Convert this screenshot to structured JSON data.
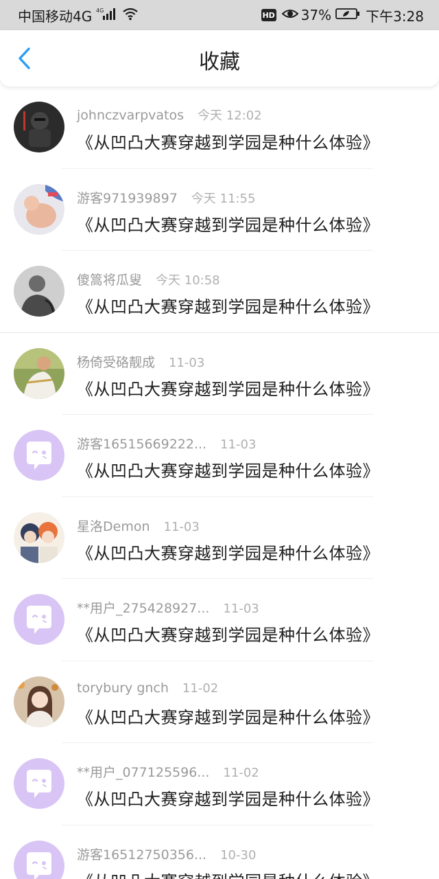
{
  "status_bar": {
    "carrier": "中国移动4G",
    "network_badge": "4G",
    "hd_badge": "HD",
    "battery_percent": "37%",
    "time": "下午3:28"
  },
  "header": {
    "title": "收藏",
    "back_icon": "chevron-left-icon",
    "accent_color": "#2a9df4"
  },
  "items": [
    {
      "user": "johnczvarpvatos",
      "time": "今天 12:02",
      "title": "《从凹凸大赛穿越到学园是种什么体验》",
      "avatar": "dark-figure-photo"
    },
    {
      "user": "游客971939897",
      "time": "今天 11:55",
      "title": "《从凹凸大赛穿越到学园是种什么体验》",
      "avatar": "baby-photo"
    },
    {
      "user": "傻篙将瓜叟",
      "time": "今天 10:58",
      "title": "《从凹凸大赛穿越到学园是种什么体验》",
      "avatar": "grayscale-person-photo"
    },
    {
      "user": "杨倚受硌靓成",
      "time": "11-03",
      "title": "《从凹凸大赛穿越到学园是种什么体验》",
      "avatar": "outdoor-person-photo"
    },
    {
      "user": "游客16515669222...",
      "time": "11-03",
      "title": "《从凹凸大赛穿越到学园是种什么体验》",
      "avatar": "default-chat-bubble-avatar"
    },
    {
      "user": "星洛Demon",
      "time": "11-03",
      "title": "《从凹凸大赛穿越到学园是种什么体验》",
      "avatar": "anime-characters-avatar"
    },
    {
      "user": "**用户_275428927...",
      "time": "11-03",
      "title": "《从凹凸大赛穿越到学园是种什么体验》",
      "avatar": "default-chat-bubble-avatar"
    },
    {
      "user": "torybury gnch",
      "time": "11-02",
      "title": "《从凹凸大赛穿越到学园是种什么体验》",
      "avatar": "girl-photo"
    },
    {
      "user": "**用户_077125596...",
      "time": "11-02",
      "title": "《从凹凸大赛穿越到学园是种什么体验》",
      "avatar": "default-chat-bubble-avatar"
    },
    {
      "user": "游客16512750356...",
      "time": "10-30",
      "title": "《从凹凸大赛穿越到学园是种什么体验》",
      "avatar": "default-chat-bubble-avatar"
    }
  ],
  "colors": {
    "default_avatar_bg": "#d9c5f5",
    "default_avatar_fg": "#ffffff"
  }
}
